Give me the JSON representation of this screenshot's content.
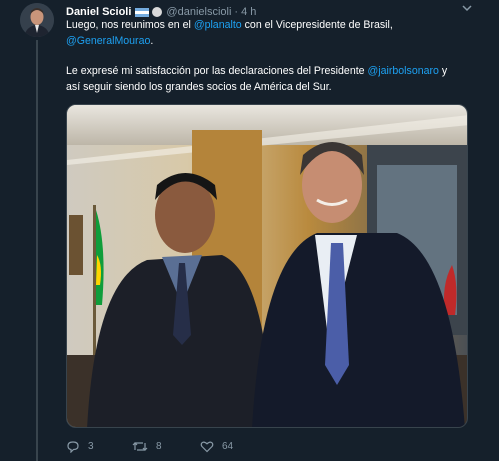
{
  "tweet": {
    "author_name": "Daniel Scioli",
    "handle": "@danielscioli",
    "separator": "·",
    "time": "4 h",
    "line1_before": "Luego, nos reunimos en el ",
    "mention1": "@planalto",
    "line1_after": " con el Vicepresidente de Brasil,",
    "mention2": "@GeneralMourao",
    "line2_end": ".",
    "line3_before": "Le expresé mi satisfacción por las declaraciones del Presidente ",
    "mention3": "@jairbolsonaro",
    "line3_after": " y",
    "line4": "así seguir siendo los grandes socios de América del Sur."
  },
  "actions": {
    "reply_count": "3",
    "retweet_count": "8",
    "like_count": "64"
  },
  "icons": {
    "flag": "argentina-flag-icon",
    "verified": "verified-badge-icon",
    "menu": "chevron-down-icon",
    "reply": "reply-icon",
    "retweet": "retweet-icon",
    "like": "heart-icon"
  },
  "colors": {
    "background": "#15202b",
    "link": "#1da1f2",
    "muted": "#8899a6"
  }
}
